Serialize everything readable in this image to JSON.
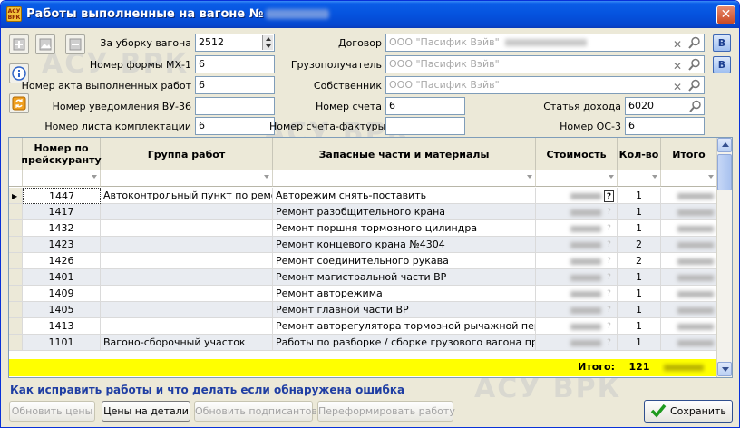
{
  "window": {
    "title": "Работы выполненные на вагоне №",
    "icon_text": "АСУ ВРК",
    "close_glyph": "✕"
  },
  "watermark": "АСУ ВРК",
  "form": {
    "cleaning_label": "За уборку вагона",
    "cleaning_value": "2512",
    "mx1_label": "Номер формы МХ-1",
    "mx1_value": "6",
    "act_label": "Номер акта выполненных работ",
    "act_value": "6",
    "vu36_label": "Номер уведомления ВУ-36",
    "vu36_value": "",
    "sheet_label": "Номер листа комплектации",
    "sheet_value": "6",
    "contract_label": "Договор",
    "contract_value": "ООО \"Пасифик Вэйв\"",
    "consignee_label": "Грузополучатель",
    "consignee_value": "ООО \"Пасифик Вэйв\"",
    "owner_label": "Собственник",
    "owner_value": "ООО \"Пасифик Вэйв\"",
    "invoice_label": "Номер счета",
    "invoice_value": "6",
    "factura_label": "Номер счета-фактуры",
    "factura_value": "",
    "income_label": "Статья дохода",
    "income_value": "6020",
    "os3_label": "Номер ОС-3",
    "os3_value": "6",
    "b_button": "B"
  },
  "table": {
    "headers": {
      "price_num": "Номер по прейскуранту",
      "group": "Группа работ",
      "parts": "Запасные части и материалы",
      "cost": "Стоимость",
      "qty": "Кол-во",
      "total": "Итого"
    },
    "rows": [
      {
        "num": "1447",
        "group": "Автоконтрольный пункт по ремо...",
        "part": "Авторежим снять-поставить",
        "qty": "1"
      },
      {
        "num": "1417",
        "group": "",
        "part": "Ремонт разобщительного крана",
        "qty": "1"
      },
      {
        "num": "1432",
        "group": "",
        "part": "Ремонт поршня тормозного цилиндра",
        "qty": "1"
      },
      {
        "num": "1423",
        "group": "",
        "part": "Ремонт концевого крана №4304",
        "qty": "2"
      },
      {
        "num": "1426",
        "group": "",
        "part": "Ремонт соединительного рукава",
        "qty": "2"
      },
      {
        "num": "1401",
        "group": "",
        "part": "Ремонт магистральной части ВР",
        "qty": "1"
      },
      {
        "num": "1409",
        "group": "",
        "part": "Ремонт авторежима",
        "qty": "1"
      },
      {
        "num": "1405",
        "group": "",
        "part": "Ремонт главной части ВР",
        "qty": "1"
      },
      {
        "num": "1413",
        "group": "",
        "part": "Ремонт авторегулятора тормозной рычажной перед...",
        "qty": "1"
      },
      {
        "num": "1101",
        "group": "Вагоно-сборочный участок",
        "part": "Работы по разборке / сборке грузового вагона произ...",
        "qty": "1"
      }
    ],
    "q_glyph": "?",
    "total_label": "Итого:",
    "total_qty": "121"
  },
  "help_link": "Как исправить работы и что делать если обнаружена ошибка",
  "buttons": {
    "refresh_prices": "Обновить цены",
    "parts_prices": "Цены на детали",
    "refresh_signers": "Обновить подписантов",
    "reform_work": "Переформировать работу",
    "save": "Сохранить"
  }
}
